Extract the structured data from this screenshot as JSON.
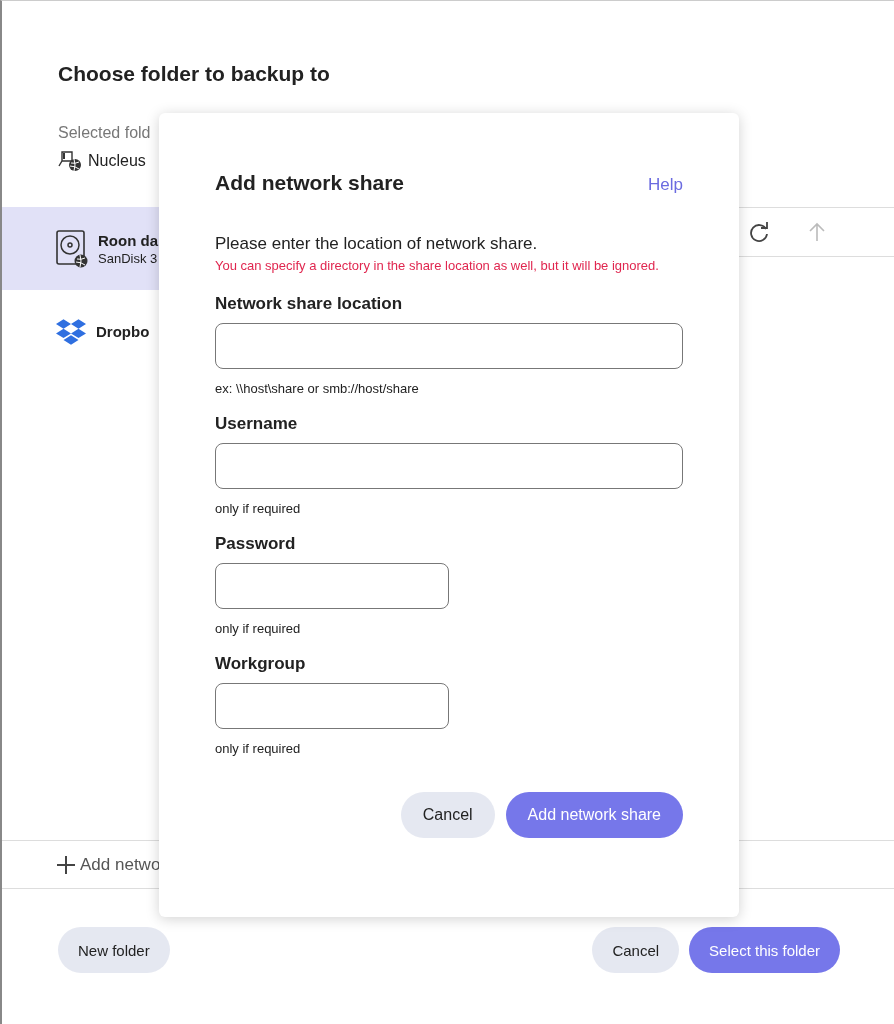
{
  "background": {
    "title": "Choose folder to backup to",
    "selected_label": "Selected fold",
    "selected_device": "Nucleus",
    "locations": [
      {
        "name": "Roon da",
        "detail": "SanDisk 3",
        "kind": "drive",
        "selected": true
      },
      {
        "name": "Dropbo",
        "kind": "dropbox",
        "selected": false
      }
    ],
    "toolbar": [
      {
        "kind": "refresh",
        "disabled": false
      },
      {
        "kind": "up",
        "disabled": true
      }
    ],
    "add_network_share": "Add netwo",
    "buttons": {
      "new_folder": "New folder",
      "cancel": "Cancel",
      "select": "Select this folder"
    }
  },
  "dialog": {
    "title": "Add network share",
    "help": "Help",
    "intro": "Please enter the location of network share.",
    "warning": "You can specify a directory in the share location as well, but it will be ignored.",
    "fields": [
      {
        "label": "Network share location",
        "hint": "ex: \\\\host\\share or smb://host/share",
        "kind": "long"
      },
      {
        "label": "Username",
        "hint": "only if required",
        "kind": "long"
      },
      {
        "label": "Password",
        "hint": "only if required",
        "kind": "short"
      },
      {
        "label": "Workgroup",
        "hint": "only if required",
        "kind": "short"
      }
    ],
    "buttons": {
      "cancel": "Cancel",
      "confirm": "Add network share"
    }
  }
}
